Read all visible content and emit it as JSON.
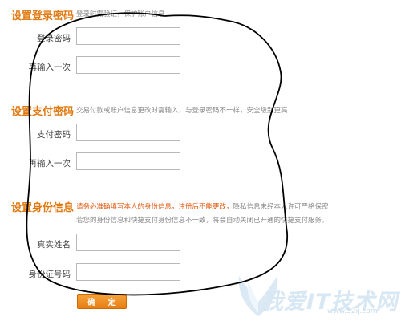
{
  "login_password": {
    "title": "设置登录密码",
    "hint": "登录时需验证，保护账户信息",
    "fields": [
      {
        "label": "登录密码",
        "value": ""
      },
      {
        "label": "再输入一次",
        "value": ""
      }
    ]
  },
  "pay_password": {
    "title": "设置支付密码",
    "hint": "交易付款或账户信息更改时需输入，与登录密码不一样，安全级别更高",
    "fields": [
      {
        "label": "支付密码",
        "value": ""
      },
      {
        "label": "再输入一次",
        "value": ""
      }
    ]
  },
  "identity": {
    "title": "设置身份信息",
    "hint_warning": "请务必准确填写本人的身份信息，注册后不能更改，",
    "hint_rest": "隐私信息未经本人许可严格保密",
    "hint_line2": "若您的身份信息和快捷支付身份信息不一致，将会自动关闭已开通的快捷支付服务。",
    "fields": [
      {
        "label": "真实姓名",
        "value": ""
      },
      {
        "label": "身份证号码",
        "value": ""
      }
    ]
  },
  "confirm_label": "确 定",
  "watermark": {
    "text": "我爱IT技术网",
    "url": "www.52ij.com"
  },
  "colors": {
    "title": "#e07a12",
    "button": "#f29a2e",
    "annotation": "#000000"
  }
}
